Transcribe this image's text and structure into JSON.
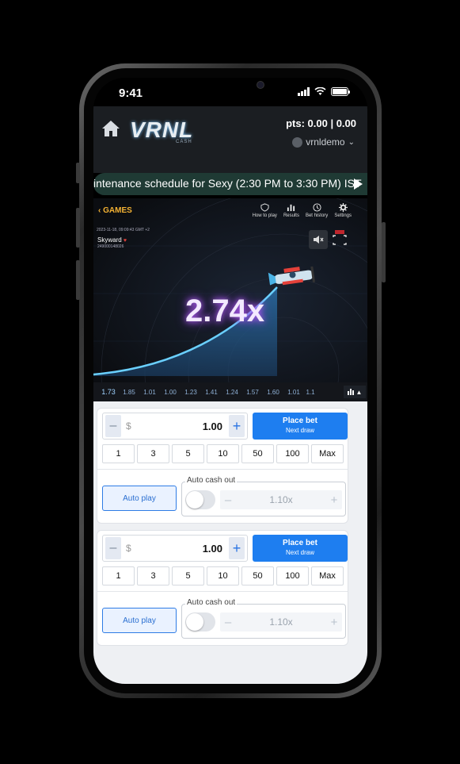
{
  "status": {
    "time": "9:41"
  },
  "header": {
    "logo": "VRNL",
    "logo_sub": "CASH",
    "points": "pts: 0.00 | 0.00",
    "username": "vrnldemo"
  },
  "marquee": {
    "text": "intenance schedule for Sexy (2:30 PM to 3:30 PM) IST"
  },
  "game": {
    "back_label": "GAMES",
    "tools": [
      {
        "label": "How to play",
        "icon": "shield-question-icon"
      },
      {
        "label": "Results",
        "icon": "bar-chart-icon"
      },
      {
        "label": "Bet history",
        "icon": "clock-history-icon"
      },
      {
        "label": "Settings",
        "icon": "gear-icon"
      }
    ],
    "date": "2023-11-18, 09:09:43 GMT +2",
    "name": "Skyward",
    "round_id": "249000148026",
    "multiplier": "2.74x",
    "history": [
      "1.73",
      "1.85",
      "1.01",
      "1.00",
      "1.23",
      "1.41",
      "1.24",
      "1.57",
      "1.60",
      "1.01",
      "1.1"
    ]
  },
  "bets": [
    {
      "currency": "$",
      "amount": "1.00",
      "place_bet": "Place bet",
      "place_bet_sub": "Next draw",
      "chips": [
        "1",
        "3",
        "5",
        "10",
        "50",
        "100",
        "Max"
      ],
      "auto_play": "Auto play",
      "auto_cash_label": "Auto cash out",
      "auto_cash_value": "1.10x"
    },
    {
      "currency": "$",
      "amount": "1.00",
      "place_bet": "Place bet",
      "place_bet_sub": "Next draw",
      "chips": [
        "1",
        "3",
        "5",
        "10",
        "50",
        "100",
        "Max"
      ],
      "auto_play": "Auto play",
      "auto_cash_label": "Auto cash out",
      "auto_cash_value": "1.10x"
    }
  ],
  "colors": {
    "accent": "#1e7ef0",
    "multiplier_glow": "#b15df3",
    "games_back": "#f4b233",
    "marquee_bg": "#1f3a34"
  }
}
